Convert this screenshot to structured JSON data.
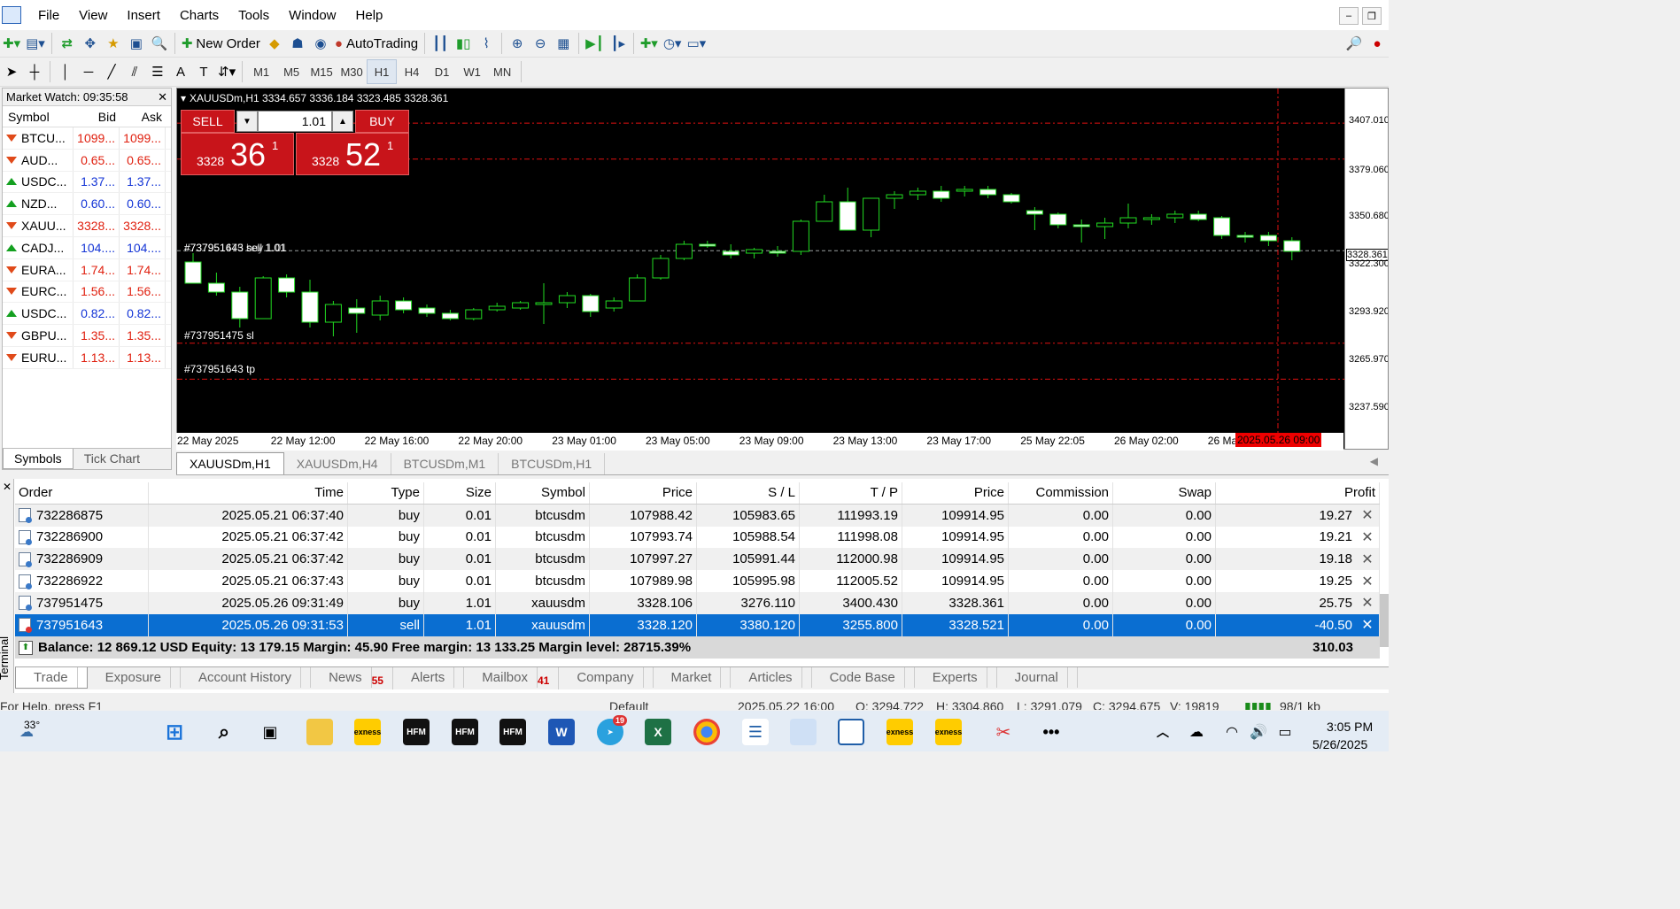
{
  "menu": [
    "File",
    "View",
    "Insert",
    "Charts",
    "Tools",
    "Window",
    "Help"
  ],
  "toolbar": {
    "new_order": "New Order",
    "auto_trading": "AutoTrading",
    "timeframes": [
      "M1",
      "M5",
      "M15",
      "M30",
      "H1",
      "H4",
      "D1",
      "W1",
      "MN"
    ],
    "active_timeframe": "H1"
  },
  "market_watch": {
    "title": "Market Watch: 09:35:58",
    "headers": [
      "Symbol",
      "Bid",
      "Ask"
    ],
    "rows": [
      {
        "symbol": "BTCU...",
        "bid": "1099...",
        "ask": "1099...",
        "dir": "down",
        "color": "#e0200f"
      },
      {
        "symbol": "AUD...",
        "bid": "0.65...",
        "ask": "0.65...",
        "dir": "down",
        "color": "#e0200f"
      },
      {
        "symbol": "USDC...",
        "bid": "1.37...",
        "ask": "1.37...",
        "dir": "up",
        "color": "#1435d6"
      },
      {
        "symbol": "NZD...",
        "bid": "0.60...",
        "ask": "0.60...",
        "dir": "up",
        "color": "#1435d6"
      },
      {
        "symbol": "XAUU...",
        "bid": "3328...",
        "ask": "3328...",
        "dir": "down",
        "color": "#e0200f"
      },
      {
        "symbol": "CADJ...",
        "bid": "104....",
        "ask": "104....",
        "dir": "up",
        "color": "#1435d6"
      },
      {
        "symbol": "EURA...",
        "bid": "1.74...",
        "ask": "1.74...",
        "dir": "down",
        "color": "#e0200f"
      },
      {
        "symbol": "EURC...",
        "bid": "1.56...",
        "ask": "1.56...",
        "dir": "down",
        "color": "#e0200f"
      },
      {
        "symbol": "USDC...",
        "bid": "0.82...",
        "ask": "0.82...",
        "dir": "up",
        "color": "#1435d6"
      },
      {
        "symbol": "GBPU...",
        "bid": "1.35...",
        "ask": "1.35...",
        "dir": "down",
        "color": "#e0200f"
      },
      {
        "symbol": "EURU...",
        "bid": "1.13...",
        "ask": "1.13...",
        "dir": "down",
        "color": "#e0200f"
      }
    ],
    "tabs": [
      "Symbols",
      "Tick Chart"
    ]
  },
  "chart": {
    "title": "XAUUSDm,H1  3334.657 3336.184 3323.485 3328.361",
    "sell_label": "SELL",
    "buy_label": "BUY",
    "volume": "1.01",
    "sell_price_small": "3328",
    "sell_price_big": "36",
    "sell_price_sup": "1",
    "buy_price_small": "3328",
    "buy_price_big": "52",
    "buy_price_sup": "1",
    "line_labels": [
      "#737951643 sell 1.01",
      "#737951475 buy 1.01",
      "#737951475 sl",
      "#737951643 tp"
    ],
    "price_axis": [
      "3407.010",
      "3379.060",
      "3350.680",
      "3328.361",
      "3322.300",
      "3293.920",
      "3265.970",
      "3237.590"
    ],
    "time_axis": [
      "22 May 2025",
      "22 May 12:00",
      "22 May 16:00",
      "22 May 20:00",
      "23 May 01:00",
      "23 May 05:00",
      "23 May 09:00",
      "23 May 13:00",
      "23 May 17:00",
      "25 May 22:05",
      "26 May 02:00",
      "26 Ma"
    ],
    "cursor_time": "2025.05.26 09:00",
    "tabs": [
      "XAUUSDm,H1",
      "XAUUSDm,H4",
      "BTCUSDm,M1",
      "BTCUSDm,H1"
    ]
  },
  "chart_data": {
    "type": "candlestick",
    "symbol": "XAUUSDm",
    "timeframe": "H1",
    "ylim": [
      3225,
      3420
    ],
    "candles": [
      {
        "o": 3322,
        "h": 3327,
        "l": 3310,
        "c": 3310
      },
      {
        "o": 3310,
        "h": 3316,
        "l": 3303,
        "c": 3305
      },
      {
        "o": 3305,
        "h": 3308,
        "l": 3285,
        "c": 3290
      },
      {
        "o": 3290,
        "h": 3314,
        "l": 3290,
        "c": 3313
      },
      {
        "o": 3313,
        "h": 3315,
        "l": 3302,
        "c": 3305
      },
      {
        "o": 3305,
        "h": 3312,
        "l": 3285,
        "c": 3288
      },
      {
        "o": 3288,
        "h": 3300,
        "l": 3280,
        "c": 3298
      },
      {
        "o": 3296,
        "h": 3301,
        "l": 3282,
        "c": 3293
      },
      {
        "o": 3292,
        "h": 3303,
        "l": 3289,
        "c": 3300
      },
      {
        "o": 3300,
        "h": 3302,
        "l": 3293,
        "c": 3295
      },
      {
        "o": 3296,
        "h": 3298,
        "l": 3291,
        "c": 3293
      },
      {
        "o": 3293,
        "h": 3295,
        "l": 3289,
        "c": 3290
      },
      {
        "o": 3290,
        "h": 3296,
        "l": 3289,
        "c": 3295
      },
      {
        "o": 3295,
        "h": 3299,
        "l": 3294,
        "c": 3297
      },
      {
        "o": 3296,
        "h": 3300,
        "l": 3295,
        "c": 3299
      },
      {
        "o": 3299,
        "h": 3310,
        "l": 3287,
        "c": 3299
      },
      {
        "o": 3299,
        "h": 3305,
        "l": 3296,
        "c": 3303
      },
      {
        "o": 3303,
        "h": 3304,
        "l": 3291,
        "c": 3294
      },
      {
        "o": 3296,
        "h": 3302,
        "l": 3294,
        "c": 3300
      },
      {
        "o": 3300,
        "h": 3315,
        "l": 3300,
        "c": 3313
      },
      {
        "o": 3313,
        "h": 3326,
        "l": 3312,
        "c": 3324
      },
      {
        "o": 3324,
        "h": 3334,
        "l": 3323,
        "c": 3332
      },
      {
        "o": 3332,
        "h": 3334,
        "l": 3330,
        "c": 3331
      },
      {
        "o": 3328,
        "h": 3332,
        "l": 3324,
        "c": 3326
      },
      {
        "o": 3327,
        "h": 3330,
        "l": 3324,
        "c": 3329
      },
      {
        "o": 3328,
        "h": 3331,
        "l": 3325,
        "c": 3327
      },
      {
        "o": 3328,
        "h": 3346,
        "l": 3326,
        "c": 3345
      },
      {
        "o": 3345,
        "h": 3360,
        "l": 3345,
        "c": 3356
      },
      {
        "o": 3356,
        "h": 3364,
        "l": 3340,
        "c": 3340
      },
      {
        "o": 3340,
        "h": 3358,
        "l": 3336,
        "c": 3358
      },
      {
        "o": 3358,
        "h": 3362,
        "l": 3352,
        "c": 3360
      },
      {
        "o": 3360,
        "h": 3364,
        "l": 3357,
        "c": 3362
      },
      {
        "o": 3362,
        "h": 3365,
        "l": 3356,
        "c": 3358
      },
      {
        "o": 3362,
        "h": 3365,
        "l": 3359,
        "c": 3363
      },
      {
        "o": 3363,
        "h": 3365,
        "l": 3358,
        "c": 3360
      },
      {
        "o": 3360,
        "h": 3361,
        "l": 3355,
        "c": 3356
      },
      {
        "o": 3351,
        "h": 3353,
        "l": 3340,
        "c": 3349
      },
      {
        "o": 3349,
        "h": 3350,
        "l": 3341,
        "c": 3343
      },
      {
        "o": 3343,
        "h": 3346,
        "l": 3333,
        "c": 3342
      },
      {
        "o": 3342,
        "h": 3347,
        "l": 3335,
        "c": 3344
      },
      {
        "o": 3344,
        "h": 3355,
        "l": 3341,
        "c": 3347
      },
      {
        "o": 3347,
        "h": 3349,
        "l": 3343,
        "c": 3347
      },
      {
        "o": 3347,
        "h": 3351,
        "l": 3344,
        "c": 3349
      },
      {
        "o": 3349,
        "h": 3351,
        "l": 3345,
        "c": 3346
      },
      {
        "o": 3347,
        "h": 3348,
        "l": 3335,
        "c": 3337
      },
      {
        "o": 3337,
        "h": 3339,
        "l": 3333,
        "c": 3336
      },
      {
        "o": 3337,
        "h": 3339,
        "l": 3331,
        "c": 3334
      },
      {
        "o": 3334,
        "h": 3336,
        "l": 3323,
        "c": 3328
      }
    ],
    "levels": [
      3400.43,
      3380.12,
      3328.361,
      3276.11,
      3255.8
    ]
  },
  "trade": {
    "headers": [
      "Order",
      "Time",
      "Type",
      "Size",
      "Symbol",
      "Price",
      "S / L",
      "T / P",
      "Price",
      "Commission",
      "Swap",
      "Profit"
    ],
    "rows": [
      [
        "732286875",
        "2025.05.21 06:37:40",
        "buy",
        "0.01",
        "btcusdm",
        "107988.42",
        "105983.65",
        "111993.19",
        "109914.95",
        "0.00",
        "0.00",
        "19.27"
      ],
      [
        "732286900",
        "2025.05.21 06:37:42",
        "buy",
        "0.01",
        "btcusdm",
        "107993.74",
        "105988.54",
        "111998.08",
        "109914.95",
        "0.00",
        "0.00",
        "19.21"
      ],
      [
        "732286909",
        "2025.05.21 06:37:42",
        "buy",
        "0.01",
        "btcusdm",
        "107997.27",
        "105991.44",
        "112000.98",
        "109914.95",
        "0.00",
        "0.00",
        "19.18"
      ],
      [
        "732286922",
        "2025.05.21 06:37:43",
        "buy",
        "0.01",
        "btcusdm",
        "107989.98",
        "105995.98",
        "112005.52",
        "109914.95",
        "0.00",
        "0.00",
        "19.25"
      ],
      [
        "737951475",
        "2025.05.26 09:31:49",
        "buy",
        "1.01",
        "xauusdm",
        "3328.106",
        "3276.110",
        "3400.430",
        "3328.361",
        "0.00",
        "0.00",
        "25.75"
      ],
      [
        "737951643",
        "2025.05.26 09:31:53",
        "sell",
        "1.01",
        "xauusdm",
        "3328.120",
        "3380.120",
        "3255.800",
        "3328.521",
        "0.00",
        "0.00",
        "-40.50"
      ]
    ],
    "balance_line": "Balance: 12 869.12 USD  Equity: 13 179.15  Margin: 45.90  Free margin: 13 133.25  Margin level: 28715.39%",
    "total_profit": "310.03"
  },
  "terminal": {
    "side_label": "Terminal",
    "tabs": [
      {
        "label": "Trade",
        "badge": ""
      },
      {
        "label": "Exposure",
        "badge": ""
      },
      {
        "label": "Account History",
        "badge": ""
      },
      {
        "label": "News",
        "badge": "55"
      },
      {
        "label": "Alerts",
        "badge": ""
      },
      {
        "label": "Mailbox",
        "badge": "41"
      },
      {
        "label": "Company",
        "badge": ""
      },
      {
        "label": "Market",
        "badge": ""
      },
      {
        "label": "Articles",
        "badge": ""
      },
      {
        "label": "Code Base",
        "badge": ""
      },
      {
        "label": "Experts",
        "badge": ""
      },
      {
        "label": "Journal",
        "badge": ""
      }
    ]
  },
  "statusbar": {
    "help": "For Help, press F1",
    "profile": "Default",
    "datetime": "2025.05.22 16:00",
    "open": "O: 3294.722",
    "high": "H: 3304.860",
    "low": "L: 3291.079",
    "close": "C: 3294.675",
    "volume": "V: 19819",
    "traffic": "98/1 kb"
  },
  "taskbar": {
    "weather": "33°",
    "time": "3:05 PM",
    "date": "5/26/2025",
    "telegram_badge": "19"
  }
}
